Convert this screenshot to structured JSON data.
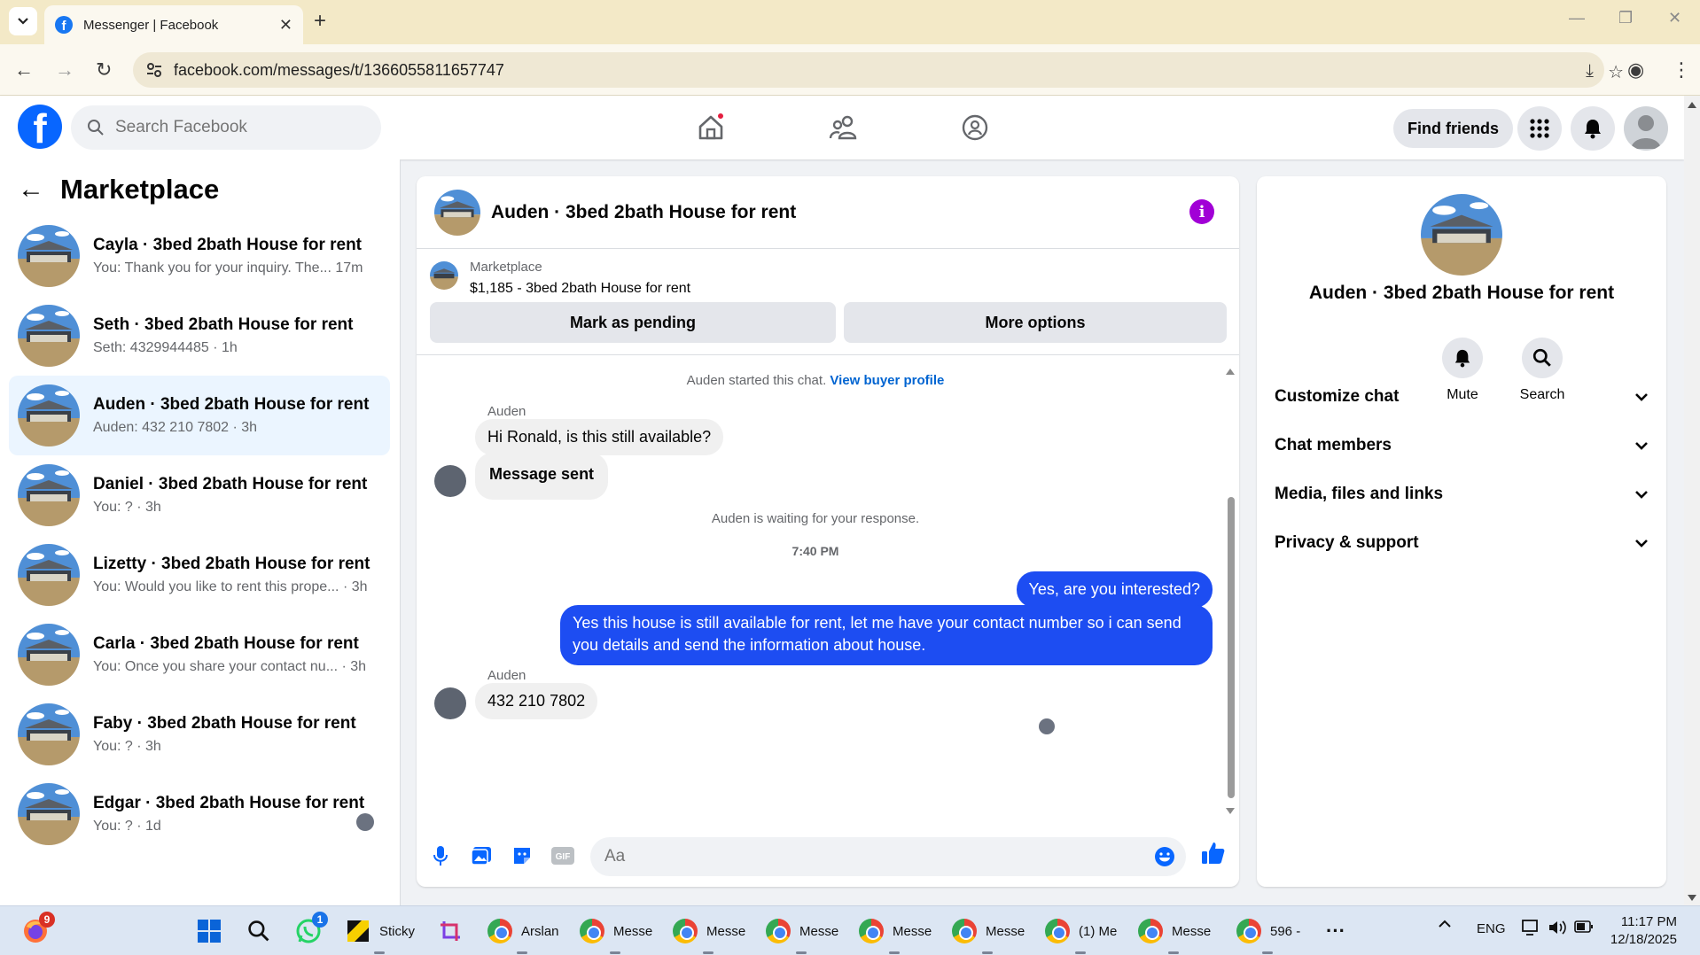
{
  "browser": {
    "tab_title": "Messenger | Facebook",
    "url": "facebook.com/messages/t/1366055811657747"
  },
  "header": {
    "search_placeholder": "Search Facebook",
    "find_friends": "Find friends"
  },
  "left": {
    "title": "Marketplace",
    "conversations": [
      {
        "name": "Cayla · 3bed 2bath House for rent",
        "preview": "You: Thank you for your inquiry. The... 17m"
      },
      {
        "name": "Seth · 3bed 2bath House for rent",
        "preview": "Seth: 4329944485 · 1h"
      },
      {
        "name": "Auden · 3bed 2bath House for rent",
        "preview": "Auden: 432 210 7802 · 3h"
      },
      {
        "name": "Daniel · 3bed 2bath House for rent",
        "preview": "You: ? · 3h"
      },
      {
        "name": "Lizetty · 3bed 2bath House for rent",
        "preview": "You: Would you like to rent this prope... · 3h"
      },
      {
        "name": "Carla · 3bed 2bath House for rent",
        "preview": "You: Once you share your contact nu...  · 3h"
      },
      {
        "name": "Faby · 3bed 2bath House for rent",
        "preview": "You: ? · 3h"
      },
      {
        "name": "Edgar · 3bed 2bath House for rent",
        "preview": "You: ? · 1d"
      }
    ]
  },
  "chat": {
    "title": "Auden · 3bed 2bath House for rent",
    "listing_source": "Marketplace",
    "listing_price": "$1,185 - 3bed 2bath House for rent",
    "mark_pending": "Mark as pending",
    "more_options": "More options",
    "started_text": "Auden started this chat.",
    "view_profile": "View buyer profile",
    "sender_name": "Auden",
    "msg1": "Hi Ronald, is this still available?",
    "msg2": "Message sent",
    "waiting": "Auden is waiting for your response.",
    "time": "7:40 PM",
    "reply1": "Yes, are you interested?",
    "reply2": "Yes this house is still available for rent, let me have your contact number so i can send you details and send the information about house.",
    "msg3": "432 210 7802",
    "input_placeholder": "Aa"
  },
  "right": {
    "title": "Auden · 3bed 2bath House for rent",
    "mute": "Mute",
    "search": "Search",
    "sections": [
      "Customize chat",
      "Chat members",
      "Media, files and links",
      "Privacy & support"
    ]
  },
  "taskbar": {
    "sticky": "Sticky",
    "arslan": "Arslan",
    "messe": "Messe",
    "one_me": "(1) Me",
    "n596": "596 -",
    "lang": "ENG",
    "time": "11:17 PM",
    "date": "12/18/2025",
    "badge_fox": "9",
    "badge_wa": "1"
  },
  "colors": {
    "fb_blue": "#0866ff",
    "outgoing_bubble": "#1d4df2",
    "info_purple": "#a100d6",
    "active_row": "#ebf5ff"
  }
}
